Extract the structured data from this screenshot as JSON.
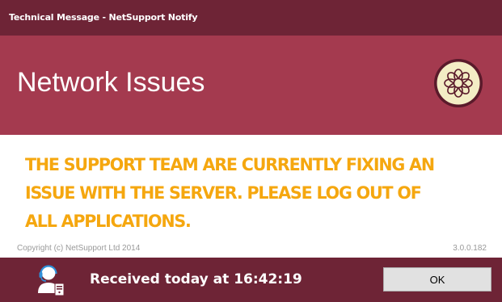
{
  "window": {
    "title": "Technical Message - NetSupport Notify"
  },
  "header": {
    "title": "Network Issues",
    "logo_icon": "flower-logo-icon"
  },
  "message": {
    "lines": [
      "THE SUPPORT TEAM ARE CURRENTLY FIXING AN",
      "ISSUE WITH THE SERVER. PLEASE LOG OUT OF",
      "ALL APPLICATIONS."
    ],
    "color": "#f5a70f"
  },
  "meta": {
    "copyright": "Copyright (c) NetSupport Ltd 2014",
    "version": "3.0.0.182"
  },
  "footer": {
    "sender_icon": "support-agent-icon",
    "received": "Received today at 16:42:19",
    "ok_label": "OK"
  },
  "colors": {
    "titlebar": "#6e2436",
    "header": "#a43a4f",
    "footer": "#6e2436"
  }
}
